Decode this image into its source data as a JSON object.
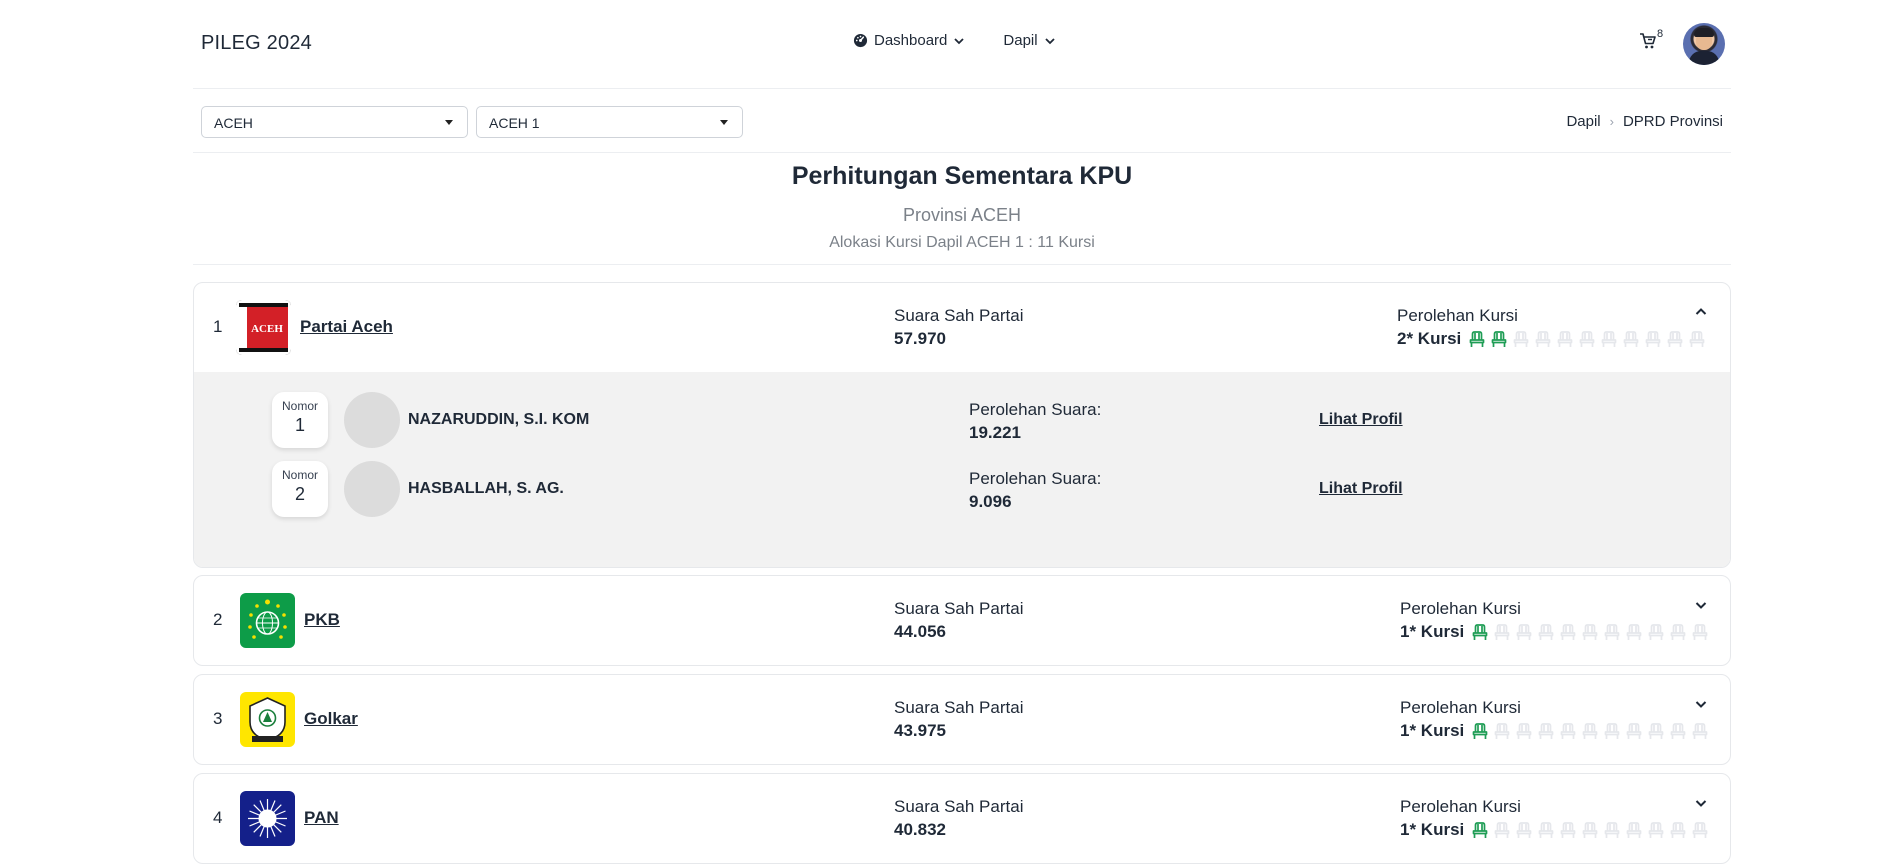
{
  "app": {
    "brand": "PILEG 2024"
  },
  "nav": {
    "dashboard": "Dashboard",
    "dapil": "Dapil",
    "cart_count": "8"
  },
  "filters": {
    "province": "ACEH",
    "dapil": "ACEH 1"
  },
  "breadcrumb": [
    "Dapil",
    "DPRD Provinsi"
  ],
  "header": {
    "title": "Perhitungan Sementara KPU",
    "subtitle": "Provinsi ACEH",
    "allocation": "Alokasi Kursi Dapil ACEH 1 : 11 Kursi"
  },
  "labels": {
    "valid_votes": "Suara Sah Partai",
    "seats": "Perolehan Kursi",
    "candidate_votes": "Perolehan Suara:",
    "number": "Nomor",
    "view_profile": "Lihat Profil"
  },
  "total_seats": 11,
  "colors": {
    "seat_filled": "#1f9d55",
    "seat_empty": "#e5e7eb"
  },
  "parties": [
    {
      "rank": "1",
      "name": "Partai Aceh",
      "logo": "partai-aceh-logo",
      "votes": "57.970",
      "seats_text": "2* Kursi",
      "seats_won": 2,
      "expanded": true,
      "candidates": [
        {
          "number": "1",
          "name": "NAZARUDDIN, S.I. KOM",
          "votes": "19.221"
        },
        {
          "number": "2",
          "name": "HASBALLAH, S. AG.",
          "votes": "9.096"
        }
      ]
    },
    {
      "rank": "2",
      "name": "PKB",
      "logo": "pkb-logo",
      "votes": "44.056",
      "seats_text": "1* Kursi",
      "seats_won": 1,
      "expanded": false
    },
    {
      "rank": "3",
      "name": "Golkar",
      "logo": "golkar-logo",
      "votes": "43.975",
      "seats_text": "1* Kursi",
      "seats_won": 1,
      "expanded": false
    },
    {
      "rank": "4",
      "name": "PAN",
      "logo": "pan-logo",
      "votes": "40.832",
      "seats_text": "1* Kursi",
      "seats_won": 1,
      "expanded": false
    }
  ]
}
